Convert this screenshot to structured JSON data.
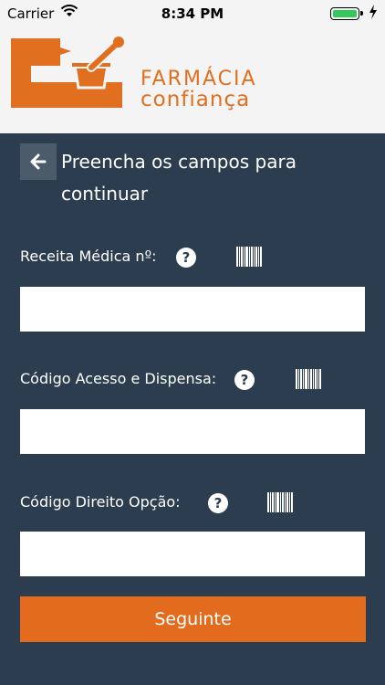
{
  "status_bar": {
    "carrier": "Carrier",
    "time": "8:34 PM"
  },
  "brand": {
    "line1": "FARMÁCIA",
    "line2": "confiança",
    "accent_color": "#e0701f"
  },
  "page": {
    "title": "Preencha os campos para continuar",
    "back_icon": "arrow-left-icon"
  },
  "form": {
    "fields": [
      {
        "label": "Receita Médica nº:",
        "value": "",
        "help_icon": "question-circle-icon",
        "scan_icon": "barcode-icon"
      },
      {
        "label": "Código Acesso e Dispensa:",
        "value": "",
        "help_icon": "question-circle-icon",
        "scan_icon": "barcode-icon"
      },
      {
        "label": "Código Direito Opção:",
        "value": "",
        "help_icon": "question-circle-icon",
        "scan_icon": "barcode-icon"
      }
    ],
    "submit_label": "Seguinte",
    "submit_color": "#e36b1e"
  },
  "background_color": "#2b3d4f"
}
